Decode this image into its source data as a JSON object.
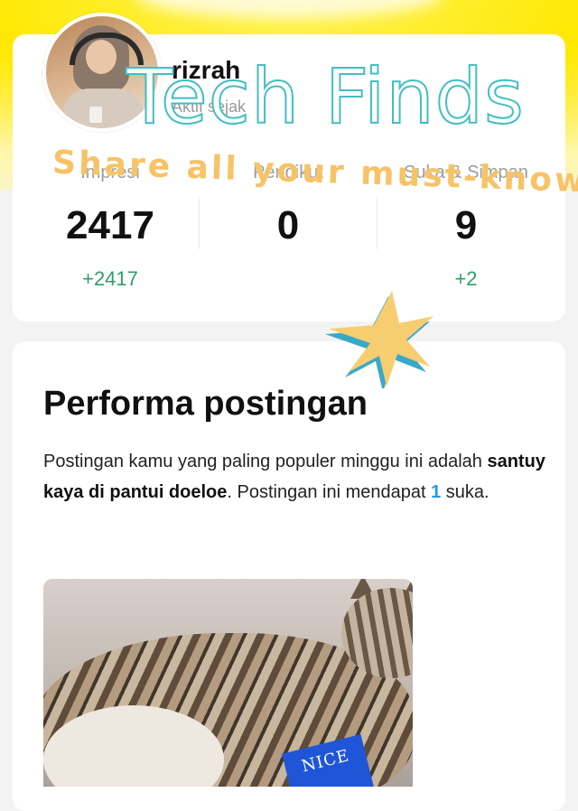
{
  "profile": {
    "username": "rizrah",
    "subtitle": "Aktif sejak"
  },
  "overlay": {
    "title": "Tech Finds",
    "tagline": "Share all your must-know",
    "title_stroke_color": "#41bfc4",
    "tagline_color": "#f6c367"
  },
  "stats": [
    {
      "label": "Impresi",
      "value": "2417",
      "delta": "+2417"
    },
    {
      "label": "Pengikut",
      "value": "0",
      "delta": ""
    },
    {
      "label": "Suka & Simpan",
      "value": "9",
      "delta": "+2"
    }
  ],
  "performance": {
    "title": "Performa postingan",
    "desc_prefix": "Postingan kamu yang paling populer minggu ini adalah ",
    "post_name": "santuy kaya di pantui doeloe",
    "desc_middle": ". Postingan ini mendapat ",
    "likes": "1",
    "desc_suffix": " suka."
  },
  "post_image": {
    "sign_text": "NICE"
  },
  "colors": {
    "accent_blue": "#1d9bf0",
    "delta_green": "#2e9f6b",
    "background_yellow": "#ffe800"
  }
}
